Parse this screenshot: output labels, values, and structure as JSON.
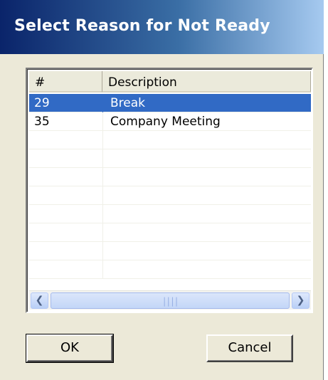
{
  "window": {
    "title": "Select Reason for Not Ready"
  },
  "list": {
    "columns": {
      "num": "#",
      "desc": "Description"
    },
    "rows": [
      {
        "num": "29",
        "desc": "Break",
        "selected": true
      },
      {
        "num": "35",
        "desc": "Company Meeting",
        "selected": false
      },
      {
        "num": "",
        "desc": "",
        "selected": false
      },
      {
        "num": "",
        "desc": "",
        "selected": false
      },
      {
        "num": "",
        "desc": "",
        "selected": false
      },
      {
        "num": "",
        "desc": "",
        "selected": false
      },
      {
        "num": "",
        "desc": "",
        "selected": false
      },
      {
        "num": "",
        "desc": "",
        "selected": false
      },
      {
        "num": "",
        "desc": "",
        "selected": false
      },
      {
        "num": "",
        "desc": "",
        "selected": false
      }
    ],
    "scrollbar": {
      "left_icon": "chevron-left-icon",
      "right_icon": "chevron-right-icon",
      "grip_icon": "grip-icon"
    }
  },
  "buttons": {
    "ok": "OK",
    "cancel": "Cancel"
  },
  "colors": {
    "selection": "#316ac5",
    "dialog_bg": "#ece9d8",
    "title_start": "#0a246a",
    "title_end": "#a6caf0"
  }
}
